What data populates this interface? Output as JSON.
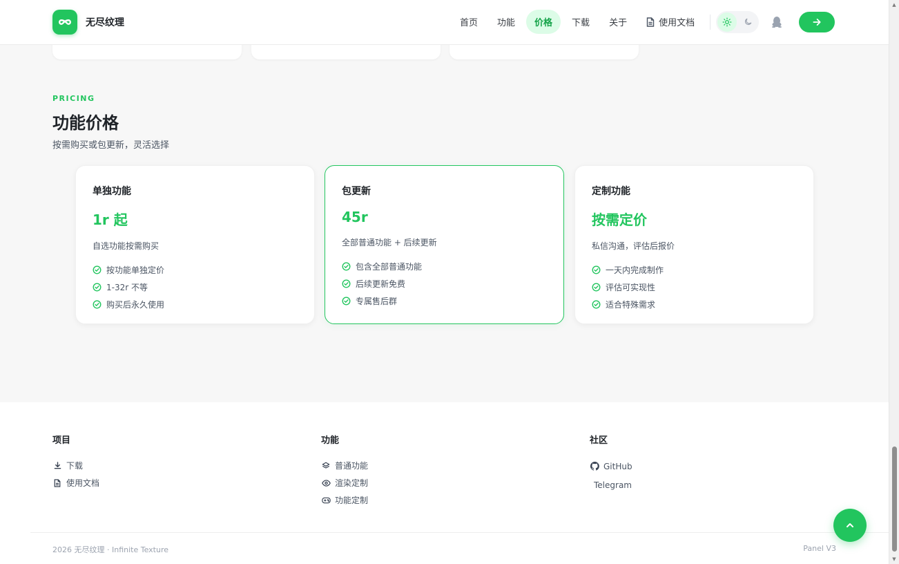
{
  "brand": {
    "name": "无尽纹理",
    "accent": "#22c55e"
  },
  "nav": {
    "items": [
      {
        "label": "首页",
        "active": false
      },
      {
        "label": "功能",
        "active": false
      },
      {
        "label": "价格",
        "active": true
      },
      {
        "label": "下载",
        "active": false
      },
      {
        "label": "关于",
        "active": false
      }
    ],
    "docs_label": "使用文档"
  },
  "pricing": {
    "eyebrow": "PRICING",
    "title": "功能价格",
    "subtitle": "按需购买或包更新，灵活选择",
    "plans": [
      {
        "name": "单独功能",
        "price": "1r 起",
        "desc": "自选功能按需购买",
        "features": [
          "按功能单独定价",
          "1-32r 不等",
          "购买后永久使用"
        ],
        "featured": false
      },
      {
        "name": "包更新",
        "price": "45r",
        "desc": "全部普通功能 + 后续更新",
        "features": [
          "包含全部普通功能",
          "后续更新免费",
          "专属售后群"
        ],
        "featured": true
      },
      {
        "name": "定制功能",
        "price": "按需定价",
        "desc": "私信沟通，评估后报价",
        "features": [
          "一天内完成制作",
          "评估可实现性",
          "适合特殊需求"
        ],
        "featured": false
      }
    ]
  },
  "footer": {
    "columns": [
      {
        "heading": "项目",
        "links": [
          {
            "label": "下载",
            "icon": "download-icon"
          },
          {
            "label": "使用文档",
            "icon": "document-icon"
          }
        ]
      },
      {
        "heading": "功能",
        "links": [
          {
            "label": "普通功能",
            "icon": "layers-icon"
          },
          {
            "label": "渲染定制",
            "icon": "eye-icon"
          },
          {
            "label": "功能定制",
            "icon": "gamepad-icon"
          }
        ]
      },
      {
        "heading": "社区",
        "links": [
          {
            "label": "GitHub",
            "icon": "github-icon"
          },
          {
            "label": "Telegram",
            "icon": ""
          }
        ]
      }
    ],
    "copyright": "2026 无尽纹理 · Infinite Texture",
    "version": "Panel V3"
  }
}
